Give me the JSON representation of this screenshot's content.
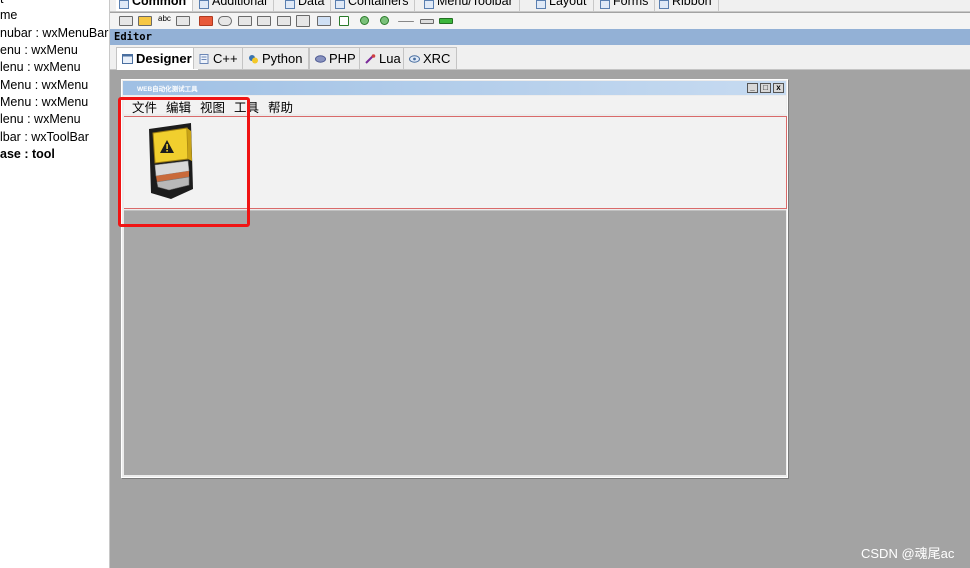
{
  "tree": {
    "items": [
      {
        "label": "t",
        "bold": false
      },
      {
        "label": "me",
        "bold": false
      },
      {
        "label": "nubar : wxMenuBar",
        "bold": false
      },
      {
        "label": "enu : wxMenu",
        "bold": false
      },
      {
        "label": "lenu : wxMenu",
        "bold": false
      },
      {
        "label": "Menu : wxMenu",
        "bold": false
      },
      {
        "label": "Menu : wxMenu",
        "bold": false
      },
      {
        "label": "lenu : wxMenu",
        "bold": false
      },
      {
        "label": "lbar : wxToolBar",
        "bold": false
      },
      {
        "label": "ase : tool",
        "bold": true
      }
    ]
  },
  "palette_tabs": [
    {
      "label": "Common",
      "active": true
    },
    {
      "label": "Additional",
      "active": false
    },
    {
      "label": "Data",
      "active": false
    },
    {
      "label": "Containers",
      "active": false
    },
    {
      "label": "Menu/Toolbar",
      "active": false
    },
    {
      "label": "Layout",
      "active": false
    },
    {
      "label": "Forms",
      "active": false
    },
    {
      "label": "Ribbon",
      "active": false
    }
  ],
  "editor": {
    "caption": "Editor",
    "tabs": [
      {
        "label": "Designer",
        "active": true,
        "icon": "designer-icon"
      },
      {
        "label": "C++",
        "active": false,
        "icon": "cpp-icon"
      },
      {
        "label": "Python",
        "active": false,
        "icon": "python-icon"
      },
      {
        "label": "PHP",
        "active": false,
        "icon": "php-icon"
      },
      {
        "label": "Lua",
        "active": false,
        "icon": "lua-icon"
      },
      {
        "label": "XRC",
        "active": false,
        "icon": "xrc-icon"
      }
    ]
  },
  "frame": {
    "title": "WEB自动化测试工具",
    "buttons": {
      "minimize": "_",
      "maximize": "□",
      "close": "x"
    },
    "menus": [
      "文件",
      "编辑",
      "视图",
      "工具",
      "帮助"
    ]
  },
  "colors": {
    "highlight": "#f01414",
    "caption_bg": "#93b1d6",
    "canvas_bg": "#a3a3a3"
  },
  "watermark": "CSDN @魂尾ac"
}
